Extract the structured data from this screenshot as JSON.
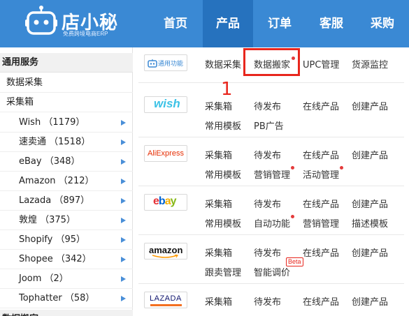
{
  "app": {
    "logo_text": "店小秘",
    "logo_sub": "免费跨境电商ERP"
  },
  "nav": [
    "首页",
    "产品",
    "订单",
    "客服",
    "采购"
  ],
  "sidebar": {
    "group1": "通用服务",
    "plain": [
      "数据采集",
      "采集箱"
    ],
    "platforms": [
      {
        "label": "Wish （1179）"
      },
      {
        "label": "速卖通 （1518）"
      },
      {
        "label": "eBay （348）"
      },
      {
        "label": "Amazon （212）"
      },
      {
        "label": "Lazada （897）"
      },
      {
        "label": "敦煌 （375）"
      },
      {
        "label": "Shopify （95）"
      },
      {
        "label": "Shopee （342）"
      },
      {
        "label": "Joom （2）"
      },
      {
        "label": "Tophatter （58）"
      }
    ],
    "group2": "数据搬家"
  },
  "panel": {
    "common": {
      "logo": "通用功能",
      "links": [
        "数据采集",
        "数据搬家",
        "UPC管理",
        "货源监控"
      ]
    },
    "wish": {
      "logo": "wish",
      "links": [
        "采集箱",
        "待发布",
        "在线产品",
        "创建产品",
        "常用模板",
        "PB广告"
      ]
    },
    "aliexpress": {
      "logo": "AliExpress",
      "links": [
        "采集箱",
        "待发布",
        "在线产品",
        "创建产品",
        "常用模板",
        "营销管理",
        "活动管理"
      ]
    },
    "ebay": {
      "logo": "ebay",
      "links": [
        "采集箱",
        "待发布",
        "在线产品",
        "创建产品",
        "常用模板",
        "自动功能",
        "营销管理",
        "描述模板"
      ]
    },
    "amazon": {
      "logo": "amazon",
      "links": [
        "采集箱",
        "待发布",
        "在线产品",
        "创建产品",
        "跟卖管理",
        "智能调价"
      ],
      "beta": "Beta"
    },
    "lazada": {
      "logo": "LAZADA",
      "links": [
        "采集箱",
        "待发布",
        "在线产品",
        "创建产品"
      ]
    }
  },
  "annotation": {
    "number": "1"
  },
  "colors": {
    "nav_bg": "#3a89d4",
    "nav_active": "#2672be",
    "highlight": "#e8261d",
    "arrow": "#4a8fd8"
  }
}
